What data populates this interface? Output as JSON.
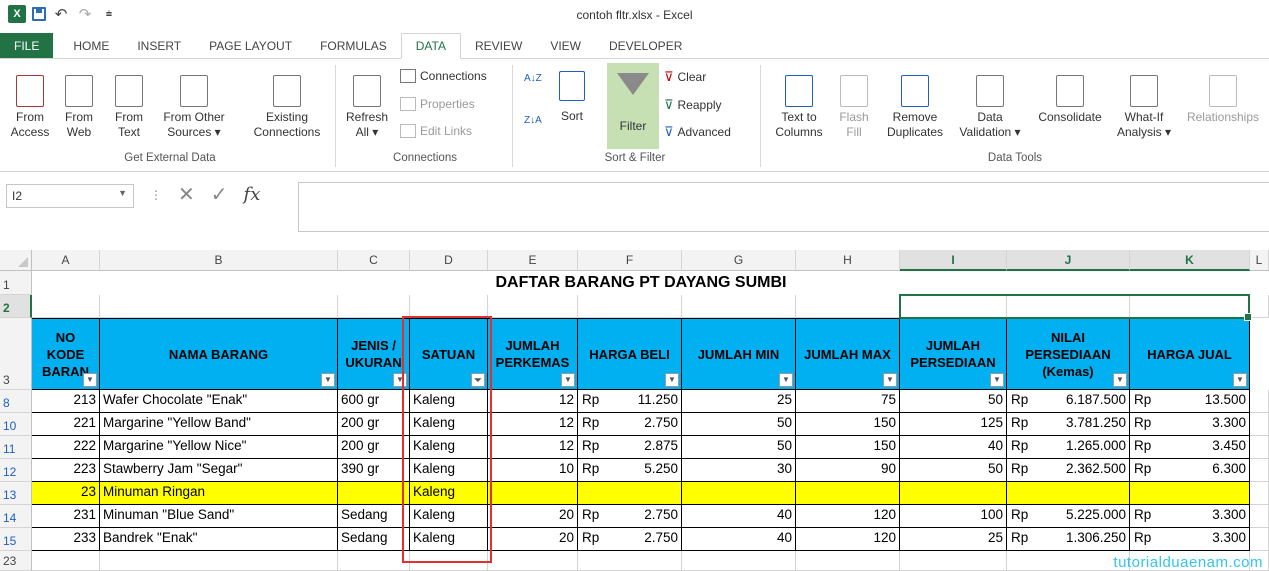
{
  "window": {
    "title": "contoh fltr.xlsx - Excel",
    "app_logo": "X"
  },
  "tabs": [
    "FILE",
    "HOME",
    "INSERT",
    "PAGE LAYOUT",
    "FORMULAS",
    "DATA",
    "REVIEW",
    "VIEW",
    "DEVELOPER"
  ],
  "ribbon": {
    "get_external_data": {
      "label": "Get External Data",
      "from_access": "From\nAccess",
      "from_web": "From\nWeb",
      "from_text": "From\nText",
      "from_other": "From Other\nSources ▾",
      "existing": "Existing\nConnections"
    },
    "connections": {
      "label": "Connections",
      "refresh": "Refresh\nAll ▾",
      "connections": "Connections",
      "properties": "Properties",
      "edit_links": "Edit Links"
    },
    "sort_filter": {
      "label": "Sort & Filter",
      "sort": "Sort",
      "filter": "Filter",
      "clear": "Clear",
      "reapply": "Reapply",
      "advanced": "Advanced"
    },
    "data_tools": {
      "label": "Data Tools",
      "text_to_columns": "Text to\nColumns",
      "flash_fill": "Flash\nFill",
      "remove_duplicates": "Remove\nDuplicates",
      "data_validation": "Data\nValidation ▾",
      "consolidate": "Consolidate",
      "what_if": "What-If\nAnalysis ▾",
      "relationships": "Relationships"
    }
  },
  "formula_bar": {
    "name_box": "I2",
    "formula": ""
  },
  "columns": [
    "A",
    "B",
    "C",
    "D",
    "E",
    "F",
    "G",
    "H",
    "I",
    "J",
    "K",
    "L"
  ],
  "sheet": {
    "title": "DAFTAR BARANG PT DAYANG SUMBI",
    "headers": [
      "NO\nKODE\nBARAN",
      "NAMA BARANG",
      "JENIS /\nUKURAN",
      "SATUAN",
      "JUMLAH\nPERKEMAS",
      "HARGA BELI",
      "JUMLAH MIN",
      "JUMLAH MAX",
      "JUMLAH\nPERSEDIAAN",
      "NILAI\nPERSEDIAAN\n(Kemas)",
      "HARGA JUAL"
    ],
    "rows": [
      {
        "row": "8",
        "kode": "213",
        "nama": "Wafer Chocolate \"Enak\"",
        "jenis": "600 gr",
        "satuan": "Kaleng",
        "perkemas": "12",
        "harga_beli": "11.250",
        "min": "25",
        "max": "75",
        "persediaan": "50",
        "nilai": "6.187.500",
        "harga_jual": "13.500"
      },
      {
        "row": "10",
        "kode": "221",
        "nama": "Margarine \"Yellow Band\"",
        "jenis": "200 gr",
        "satuan": "Kaleng",
        "perkemas": "12",
        "harga_beli": "2.750",
        "min": "50",
        "max": "150",
        "persediaan": "125",
        "nilai": "3.781.250",
        "harga_jual": "3.300"
      },
      {
        "row": "11",
        "kode": "222",
        "nama": "Margarine \"Yellow Nice\"",
        "jenis": "200 gr",
        "satuan": "Kaleng",
        "perkemas": "12",
        "harga_beli": "2.875",
        "min": "50",
        "max": "150",
        "persediaan": "40",
        "nilai": "1.265.000",
        "harga_jual": "3.450"
      },
      {
        "row": "12",
        "kode": "223",
        "nama": "Stawberry Jam \"Segar\"",
        "jenis": "390 gr",
        "satuan": "Kaleng",
        "perkemas": "10",
        "harga_beli": "5.250",
        "min": "30",
        "max": "90",
        "persediaan": "50",
        "nilai": "2.362.500",
        "harga_jual": "6.300"
      },
      {
        "row": "13",
        "kode": "23",
        "nama": "Minuman Ringan",
        "jenis": "",
        "satuan": "Kaleng",
        "perkemas": "",
        "harga_beli": "",
        "min": "",
        "max": "",
        "persediaan": "",
        "nilai": "",
        "harga_jual": "",
        "highlight": true
      },
      {
        "row": "14",
        "kode": "231",
        "nama": "Minuman \"Blue Sand\"",
        "jenis": "Sedang",
        "satuan": "Kaleng",
        "perkemas": "20",
        "harga_beli": "2.750",
        "min": "40",
        "max": "120",
        "persediaan": "100",
        "nilai": "5.225.000",
        "harga_jual": "3.300"
      },
      {
        "row": "15",
        "kode": "233",
        "nama": "Bandrek \"Enak\"",
        "jenis": "Sedang",
        "satuan": "Kaleng",
        "perkemas": "20",
        "harga_beli": "2.750",
        "min": "40",
        "max": "120",
        "persediaan": "25",
        "nilai": "1.306.250",
        "harga_jual": "3.300"
      }
    ],
    "currency": "Rp",
    "row_labels": {
      "r1": "1",
      "r2": "2",
      "r3": "3",
      "r23": "23"
    }
  },
  "watermark": "tutorialduaenam.com",
  "colors": {
    "excel_green": "#217346",
    "header_blue": "#00b0f0",
    "highlight_yellow": "#ffff00",
    "annotation_red": "#e03030"
  }
}
